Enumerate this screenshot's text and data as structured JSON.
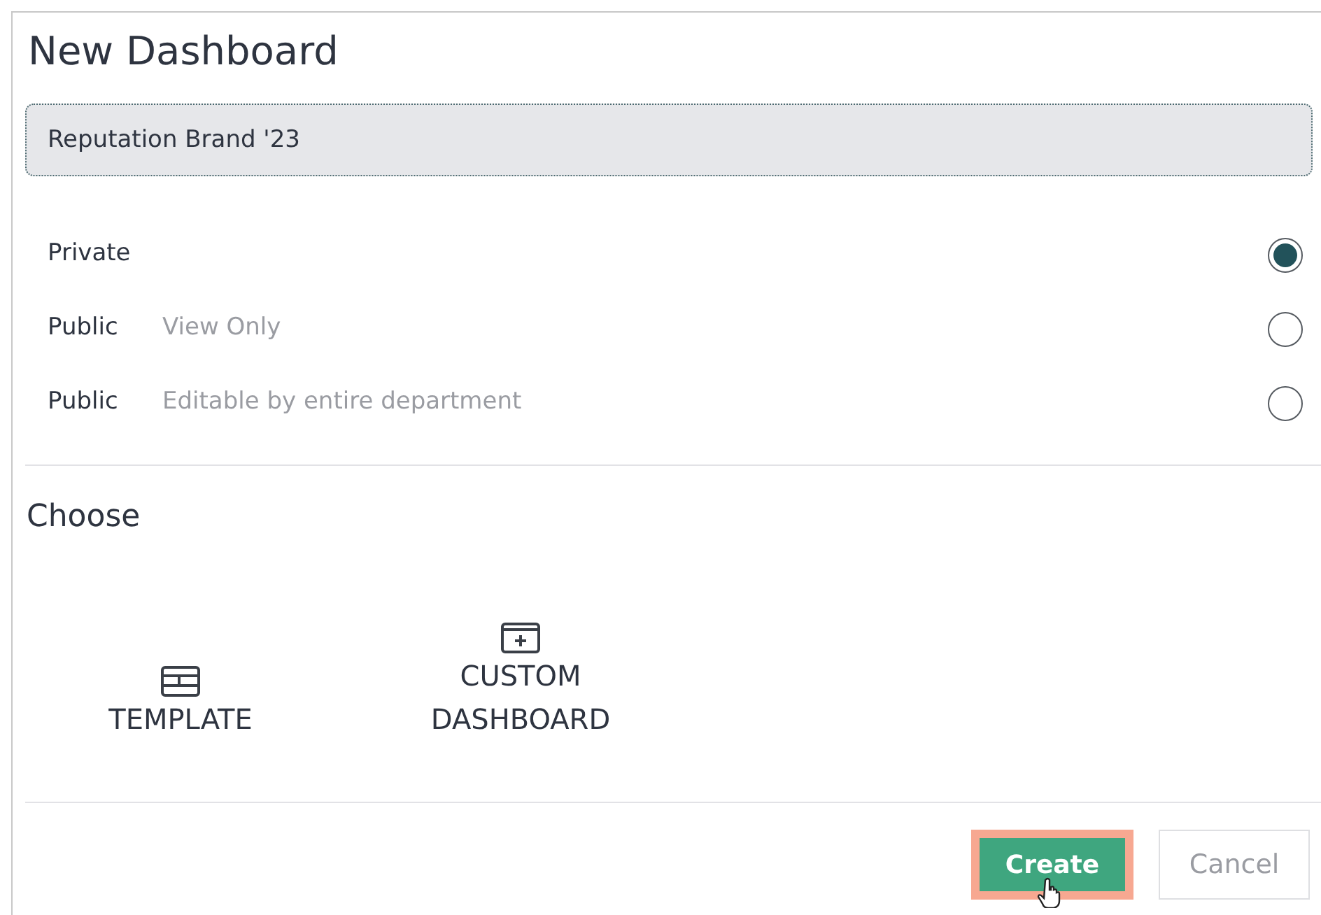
{
  "dialog": {
    "title": "New Dashboard"
  },
  "name_field": {
    "value": "Reputation Brand '23"
  },
  "visibility_options": [
    {
      "label": "Private",
      "selected": true
    },
    {
      "label": "Public",
      "description": "View Only",
      "selected": false
    },
    {
      "label": "Public",
      "description": "Editable by entire department",
      "selected": false
    }
  ],
  "choose": {
    "heading": "Choose",
    "options": [
      {
        "kind": "template",
        "label": "TEMPLATE"
      },
      {
        "kind": "custom",
        "label": "CUSTOM DASHBOARD"
      }
    ]
  },
  "buttons": [
    {
      "kind": "primary",
      "label": "Create",
      "highlighted": true,
      "hovered": true
    },
    {
      "kind": "secondary",
      "label": "Cancel",
      "highlighted": false,
      "hovered": false
    }
  ]
}
